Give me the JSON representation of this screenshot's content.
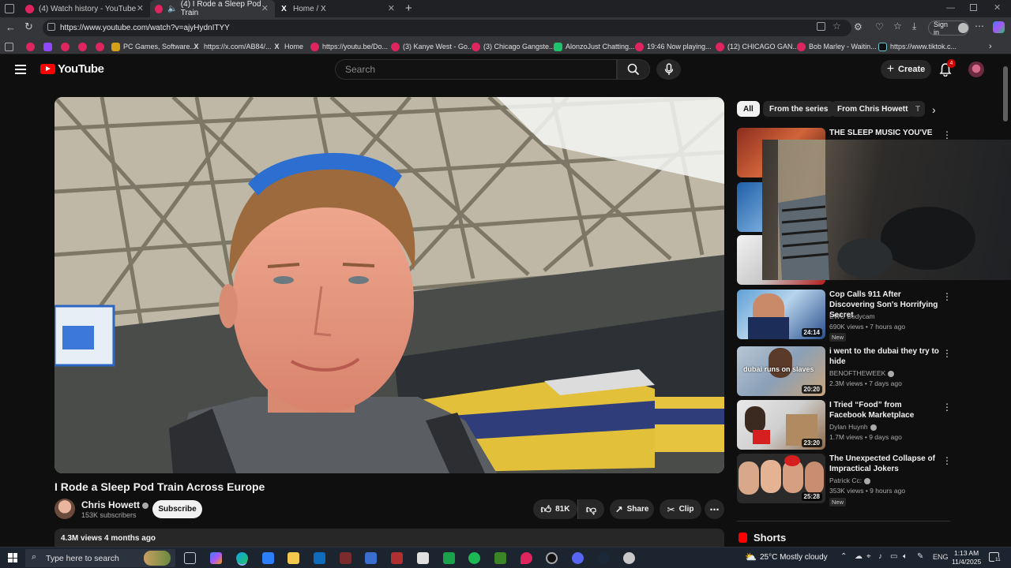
{
  "browser": {
    "tabs": [
      {
        "title": "(4) Watch history - YouTube"
      },
      {
        "title": "(4) I Rode a Sleep Pod Train"
      },
      {
        "title": "Home / X"
      }
    ],
    "url": "https://www.youtube.com/watch?v=ajyHydnITYY",
    "sign_in": "Sign in",
    "bookmarks": [
      "PC Games, Software...",
      "https://x.com/AB84/...",
      "Home",
      "https://youtu.be/Do...",
      "(3) Kanye West - Go...",
      "(3) Chicago Gangste...",
      "AlonzoJust Chatting...",
      "19:46 Now playing...",
      "(12) CHICAGO GAN...",
      "Bob Marley - Waitin...",
      "https://www.tiktok.c..."
    ]
  },
  "youtube": {
    "logo_text": "YouTube",
    "search_placeholder": "Search",
    "create_label": "Create",
    "notification_count": "4"
  },
  "video": {
    "title": "I Rode a Sleep Pod Train Across Europe",
    "channel": "Chris Howett",
    "subscribers": "153K subscribers",
    "subscribe_label": "Subscribe",
    "likes": "81K",
    "share_label": "Share",
    "clip_label": "Clip",
    "description_meta": "4.3M views  4 months ago"
  },
  "chips": [
    "All",
    "From the series",
    "From Chris Howett",
    "T"
  ],
  "recommendations": [
    {
      "title": "THE SLEEP MUSIC YOU'VE",
      "channel": "",
      "meta": "",
      "duration": "",
      "badge": ""
    },
    {
      "title": "",
      "channel": "",
      "meta": "",
      "duration": "",
      "badge": ""
    },
    {
      "title": "",
      "channel": "",
      "meta": "",
      "duration": "",
      "badge": ""
    },
    {
      "title": "Cop Calls 911 After Discovering Son's Horrifying Secret",
      "channel": "EWU Bodycam",
      "meta": "690K views • 7 hours ago",
      "duration": "24:14",
      "badge": "New"
    },
    {
      "title": "i went to the dubai they try to hide",
      "channel": "BENOFTHEWEEK",
      "meta": "2.3M views • 7 days ago",
      "duration": "20:20",
      "badge": "",
      "thumb_text": "dubai runs on slaves"
    },
    {
      "title": "I Tried “Food” from Facebook Marketplace",
      "channel": "Dylan Huynh",
      "meta": "1.7M views • 9 days ago",
      "duration": "23:20",
      "badge": ""
    },
    {
      "title": "The Unexpected Collapse of Impractical Jokers",
      "channel": "Patrick Cc:",
      "meta": "353K views • 9 hours ago",
      "duration": "25:28",
      "badge": "New"
    }
  ],
  "shorts_label": "Shorts",
  "taskbar": {
    "search_placeholder": "Type here to search",
    "weather": "25°C  Mostly cloudy",
    "language": "ENG",
    "time": "1:13 AM",
    "date": "11/4/2025",
    "notif_count": "11"
  },
  "colors": {
    "youtube_red": "#ff0000",
    "background": "#0f0f0f",
    "chip_bg": "#272727"
  }
}
